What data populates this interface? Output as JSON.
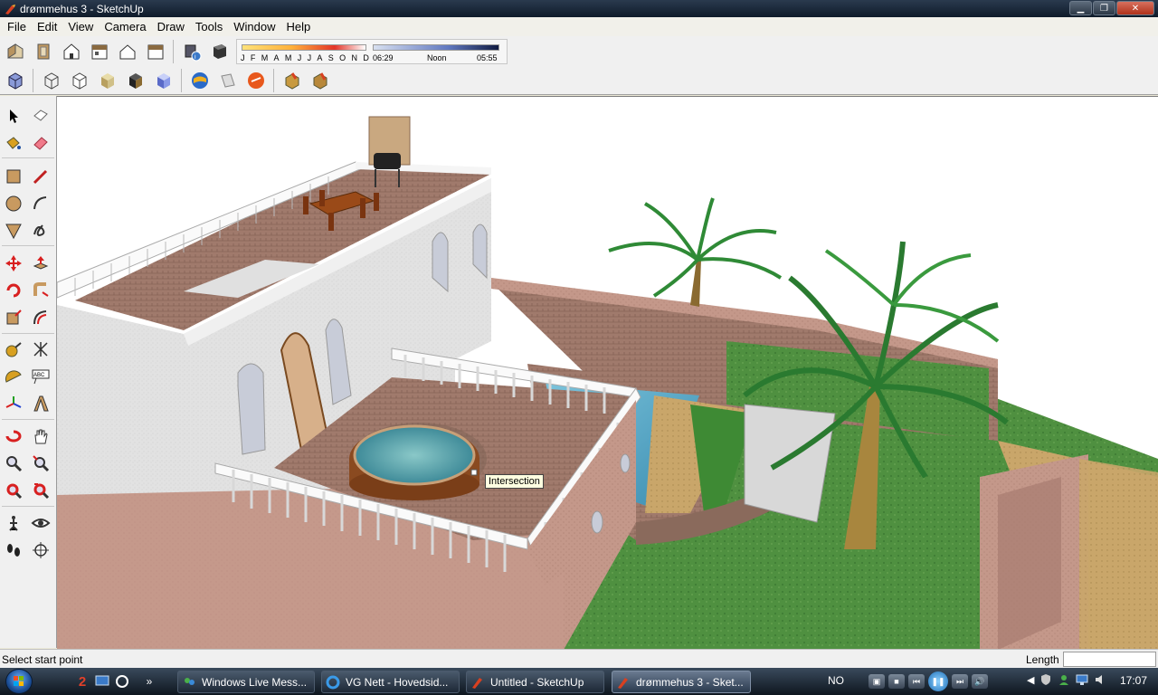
{
  "window": {
    "title": "drømmehus 3 - SketchUp",
    "controls": {
      "minimize": "▁",
      "maximize": "❐",
      "close": "✕"
    }
  },
  "menu": [
    "File",
    "Edit",
    "View",
    "Camera",
    "Draw",
    "Tools",
    "Window",
    "Help"
  ],
  "toolbar": {
    "row1_icons": [
      "iso-view-icon",
      "top-view-icon",
      "front-view-icon",
      "right-view-icon",
      "back-view-icon",
      "left-view-icon",
      "shadow-settings-icon",
      "display-shadows-icon"
    ],
    "row2_icons": [
      "xray-icon",
      "wireframe-icon",
      "hidden-line-icon",
      "shaded-icon",
      "shaded-textures-icon",
      "monochrome-icon",
      "google-earth-icon",
      "get-models-icon",
      "share-model-icon",
      "components-icon",
      "dynamic-components-icon"
    ],
    "shadows": {
      "months": [
        "J",
        "F",
        "M",
        "A",
        "M",
        "J",
        "J",
        "A",
        "S",
        "O",
        "N",
        "D"
      ],
      "time_start": "06:29",
      "time_mid": "Noon",
      "time_end": "05:55"
    }
  },
  "palette_tools": [
    "select-tool-icon",
    "make-component-icon",
    "paint-bucket-icon",
    "eraser-icon",
    "rectangle-icon",
    "line-icon",
    "circle-icon",
    "arc-icon",
    "polygon-icon",
    "freehand-icon",
    "move-icon",
    "push-pull-icon",
    "rotate-icon",
    "follow-me-icon",
    "scale-icon",
    "offset-icon",
    "tape-measure-icon",
    "dimension-icon",
    "protractor-icon",
    "text-icon",
    "axes-icon",
    "3d-text-icon",
    "orbit-icon",
    "pan-icon",
    "zoom-icon",
    "zoom-window-icon",
    "zoom-extents-icon",
    "previous-view-icon",
    "position-camera-icon",
    "look-around-icon",
    "walk-icon",
    "section-plane-icon"
  ],
  "viewport": {
    "tooltip": "Intersection"
  },
  "status": {
    "message": "Select start point",
    "vcb_label": "Length",
    "vcb_value": ""
  },
  "taskbar": {
    "quicklaunch_badge": "2",
    "more": "»",
    "tasks": [
      {
        "label": "Windows Live Mess...",
        "active": false
      },
      {
        "label": "VG Nett - Hovedsid...",
        "active": false
      },
      {
        "label": "Untitled - SketchUp",
        "active": false
      },
      {
        "label": "drømmehus 3 - Sket...",
        "active": true
      }
    ],
    "language": "NO",
    "clock": "17:07"
  },
  "colors": {
    "sky": "#ffffff",
    "grass": "#4a8c3a",
    "wall_white": "#e6e6e6",
    "brick": "#c49080",
    "water": "#5aa8c8",
    "palm": "#2f8a36"
  }
}
